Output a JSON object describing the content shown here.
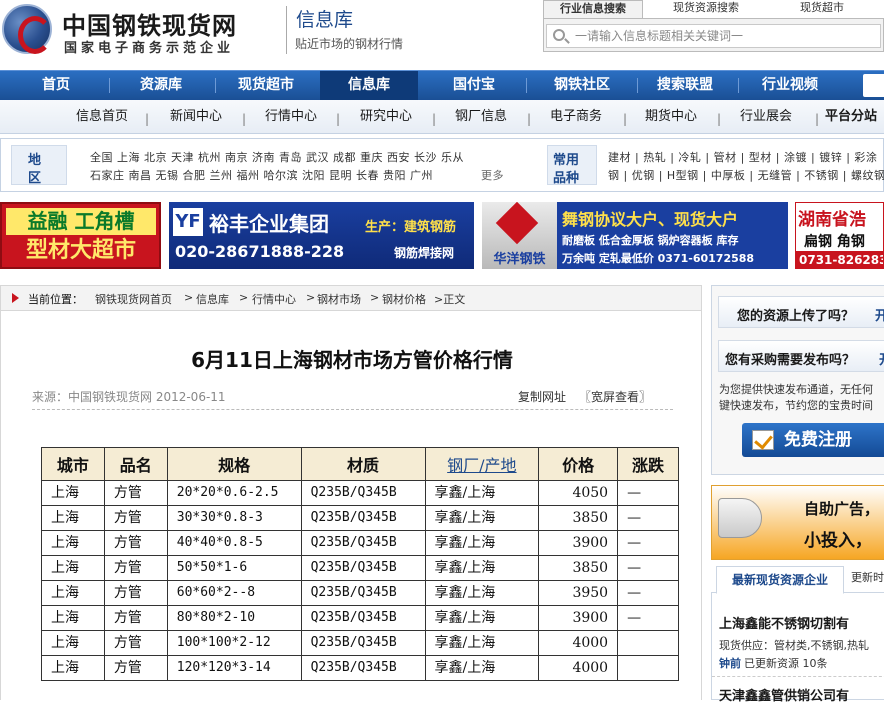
{
  "header": {
    "logo_title": "中国钢铁现货网",
    "logo_subtitle": "国家电子商务示范企业",
    "section_title": "信息库",
    "section_subtitle": "贴近市场的钢材行情",
    "search_tabs": [
      "行业信息搜索",
      "现货资源搜索",
      "现货超市"
    ],
    "search_placeholder": "一请输入信息标题相关关键词一"
  },
  "nav": {
    "items": [
      "首页",
      "资源库",
      "现货超市",
      "信息库",
      "国付宝",
      "钢铁社区",
      "搜索联盟",
      "行业视频"
    ]
  },
  "subnav": {
    "items": [
      "信息首页",
      "新闻中心",
      "行情中心",
      "研究中心",
      "钢厂信息",
      "电子商务",
      "期货中心",
      "行业展会",
      "平台分站"
    ]
  },
  "region": {
    "label_1": "地",
    "label_2": "区",
    "line1": "全国 上海 北京 天津 杭州 南京 济南 青岛 武汉 成都 重庆 西安 长沙 乐从",
    "line2": "石家庄 南昌 无锡 合肥 兰州 福州 哈尔滨 沈阳 昆明 长春 贵阳 广州",
    "more": "更多",
    "product_label_1": "常用",
    "product_label_2": "品种",
    "products1": "建材 | 热轧 | 冷轧 | 管材 | 型材 | 涂镀 | 镀锌 | 彩涂",
    "products2": "钢 | 优钢 | H型钢 | 中厚板 | 无缝管 | 不锈钢 | 螺纹钢"
  },
  "ads": {
    "ad1_line1": "益融 工角槽",
    "ad1_line2": "型材大超市",
    "ad2_name": "裕丰企业集团",
    "ad2_tag": "生产：建筑钢筋",
    "ad2_phone": "020-28671888-228",
    "ad2_tag2": "钢筋焊接网",
    "ad3_company": "华洋钢铁",
    "ad3_line1": "舞钢协议大户、现货大户",
    "ad3_line2": "耐磨板 低合金厚板 锅炉容器板 库存",
    "ad3_line3": "万余吨 定轧最低价 0371-60172588",
    "ad4_line1": "湖南省浩",
    "ad4_line2": "扁钢 角钢",
    "ad4_line3": "0731-826283"
  },
  "breadcrumb": {
    "label": "当前位置：",
    "items": [
      "钢铁现货网首页",
      "信息库",
      "行情中心",
      "钢材市场",
      "钢材价格"
    ],
    "current": ">正文"
  },
  "article": {
    "title": "6月11日上海钢材市场方管价格行情",
    "source": "来源：中国钢铁现货网 2012-06-11",
    "copy_link": "复制网址",
    "wide_view": "〖宽屏查看〗",
    "table": {
      "headers": [
        "城市",
        "品名",
        "规格",
        "材质",
        "钢厂/产地",
        "价格",
        "涨跌"
      ],
      "rows": [
        [
          "上海",
          "方管",
          "20*20*0.6-2.5",
          "Q235B/Q345B",
          "享鑫/上海",
          "4050",
          "—"
        ],
        [
          "上海",
          "方管",
          "30*30*0.8-3",
          "Q235B/Q345B",
          "享鑫/上海",
          "3850",
          "—"
        ],
        [
          "上海",
          "方管",
          "40*40*0.8-5",
          "Q235B/Q345B",
          "享鑫/上海",
          "3900",
          "—"
        ],
        [
          "上海",
          "方管",
          "50*50*1-6",
          "Q235B/Q345B",
          "享鑫/上海",
          "3850",
          "—"
        ],
        [
          "上海",
          "方管",
          "60*60*2--8",
          "Q235B/Q345B",
          "享鑫/上海",
          "3950",
          "—"
        ],
        [
          "上海",
          "方管",
          "80*80*2-10",
          "Q235B/Q345B",
          "享鑫/上海",
          "3900",
          "—"
        ],
        [
          "上海",
          "方管",
          "100*100*2-12",
          "Q235B/Q345B",
          "享鑫/上海",
          "4000",
          ""
        ],
        [
          "上海",
          "方管",
          "120*120*3-14",
          "Q235B/Q345B",
          "享鑫/上海",
          "4000",
          ""
        ]
      ]
    }
  },
  "sidebar": {
    "q1": "您的资源上传了吗？",
    "q1_more": "开",
    "q2": "您有采购需要发布吗？",
    "q2_more": "开",
    "desc1": "为您提供快速发布通道，无任何",
    "desc2": "键快速发布，节约您的宝贵时间",
    "register": "免费注册",
    "ad_line1": "自助广告，",
    "ad_line2": "小投入，",
    "tab_active": "最新现货资源企业",
    "tab_inactive": "更新时",
    "company1": "上海鑫能不锈钢切割有",
    "company1_desc": "现货供应：管材类,不锈钢,热轧",
    "company1_update_name": "钟前",
    "company1_update_text": "已更新资源 10条",
    "company2": "天津鑫鑫管供销公司有"
  },
  "colors": {
    "nav_blue": "#1a4f95",
    "brand_red": "#c8141e",
    "table_header": "#f5ecd4",
    "link_blue": "#1e4a8c"
  }
}
